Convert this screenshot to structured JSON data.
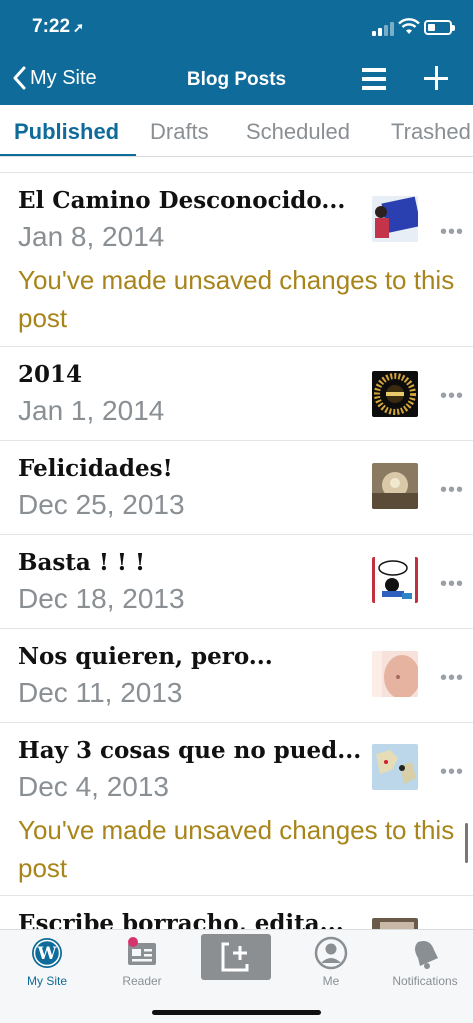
{
  "status": {
    "time": "7:22",
    "location_icon": "location-arrow-icon"
  },
  "nav": {
    "back_label": "My Site",
    "title": "Blog Posts"
  },
  "tabs": [
    "Published",
    "Drafts",
    "Scheduled",
    "Trashed"
  ],
  "active_tab": "Published",
  "posts": [
    {
      "title": "El Camino Desconocido...",
      "date": "Jan 8, 2014",
      "warning": "You've made unsaved changes to this post"
    },
    {
      "title": "2014",
      "date": "Jan 1, 2014",
      "warning": ""
    },
    {
      "title": "Felicidades!",
      "date": "Dec 25, 2013",
      "warning": ""
    },
    {
      "title": "Basta ! ! !",
      "date": "Dec 18, 2013",
      "warning": ""
    },
    {
      "title": "Nos quieren, pero...",
      "date": "Dec 11, 2013",
      "warning": ""
    },
    {
      "title": "Hay 3 cosas que no pued...",
      "date": "Dec 4, 2013",
      "warning": "You've made unsaved changes to this post"
    },
    {
      "title": "Escribe borracho, edita...",
      "date": "",
      "warning": ""
    }
  ],
  "more_glyph": "•••",
  "bottom_tabs": {
    "my_site": "My Site",
    "reader": "Reader",
    "me": "Me",
    "notifications": "Notifications"
  },
  "colors": {
    "brand": "#0f6b9a",
    "warning": "#a8851b",
    "muted": "#8a8f94",
    "badge": "#d6336c"
  }
}
